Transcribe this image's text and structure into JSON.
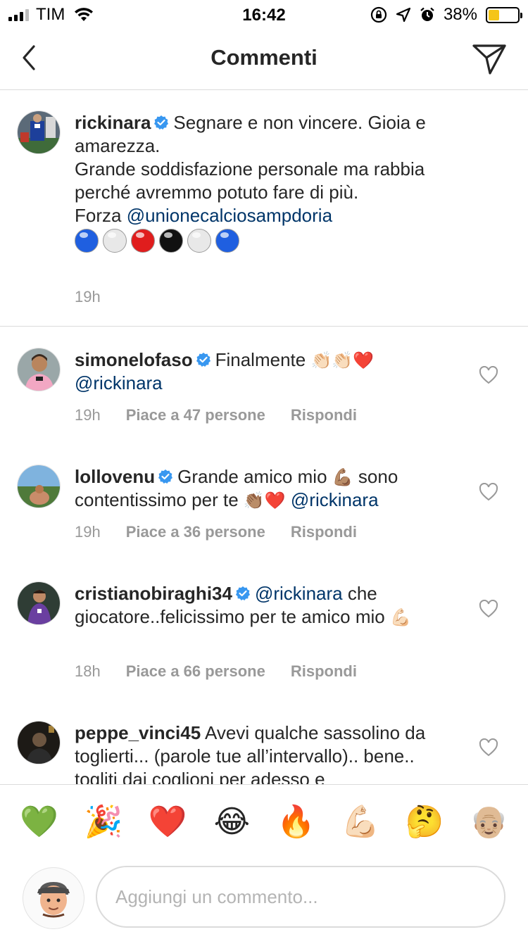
{
  "status_bar": {
    "carrier": "TIM",
    "time": "16:42",
    "battery_percent": "38%",
    "battery_level": 0.38,
    "battery_color": "#f5c518",
    "icons": [
      "signal-icon",
      "wifi-icon",
      "rotation-lock-icon",
      "location-icon",
      "alarm-icon",
      "battery-icon"
    ]
  },
  "nav": {
    "title": "Commenti",
    "back_icon": "chevron-left-icon",
    "send_icon": "direct-send-icon"
  },
  "caption": {
    "username": "rickinara",
    "verified": true,
    "text_1": "Segnare e non vincere. Gioia e amarezza.",
    "text_2": "Grande soddisfazione personale ma rabbia perché avremmo potuto fare di più.",
    "text_3_prefix": "Forza ",
    "text_3_mention": "@unionecalciosampdoria",
    "emoji_dots": [
      "#1f5fe0",
      "#e8e8e8",
      "#e01d1d",
      "#111111",
      "#e8e8e8",
      "#1f5fe0"
    ],
    "time": "19h"
  },
  "comments": [
    {
      "username": "simonelofaso",
      "verified": true,
      "text_before": "Finalmente ",
      "emojis": "👏🏻👏🏻❤️",
      "text_after": "",
      "mention": "@rickinara",
      "time": "19h",
      "likes": "Piace a 47 persone",
      "reply": "Rispondi"
    },
    {
      "username": "lollovenu",
      "verified": true,
      "text_before": "Grande amico mio ",
      "emoji_1": "💪🏽",
      "text_middle": " sono contentissimo per te ",
      "emoji_2": "👏🏽❤️",
      "mention": "@rickinara",
      "time": "19h",
      "likes": "Piace a 36 persone",
      "reply": "Rispondi"
    },
    {
      "username": "cristianobiraghi34",
      "verified": true,
      "mention": "@rickinara",
      "text": " che giocatore..felicissimo per te amico mio ",
      "emoji": "💪🏻",
      "time": "18h",
      "likes": "Piace a 66 persone",
      "reply": "Rispondi"
    },
    {
      "username": "peppe_vinci45",
      "verified": false,
      "text": "Avevi qualche sassolino da toglierti... (parole tue all’intervallo).. bene.. togliti dai coglioni per adesso e"
    }
  ],
  "emoji_bar": [
    "💚",
    "🎉",
    "❤️",
    "😂",
    "🔥",
    "💪🏻",
    "🤔",
    "👴🏼"
  ],
  "composer": {
    "placeholder": "Aggiungi un commento..."
  },
  "colors": {
    "mention": "#003569",
    "secondary_text": "#999999",
    "divider": "#dbdbdb",
    "verified_badge": "#3897f0"
  }
}
